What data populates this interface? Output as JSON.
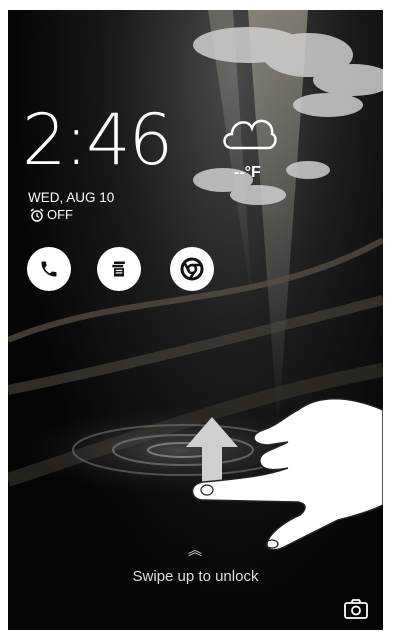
{
  "lockscreen": {
    "time": "2:46",
    "temperature": "--°F",
    "date": "WED, AUG 10",
    "alarm_status": "OFF",
    "unlock_hint": "Swipe up to unlock"
  },
  "shortcuts": [
    {
      "icon": "phone-icon"
    },
    {
      "icon": "notes-icon"
    },
    {
      "icon": "chrome-icon"
    }
  ],
  "icons": {
    "weather": "cloud-icon",
    "alarm": "alarm-clock-icon",
    "camera": "camera-icon",
    "swipe": "chevron-up-double-icon"
  },
  "colors": {
    "background": "#0a0a0a",
    "text": "#ffffff",
    "shortcut_bg": "#ffffff",
    "arrow": "#cfcfcf"
  }
}
